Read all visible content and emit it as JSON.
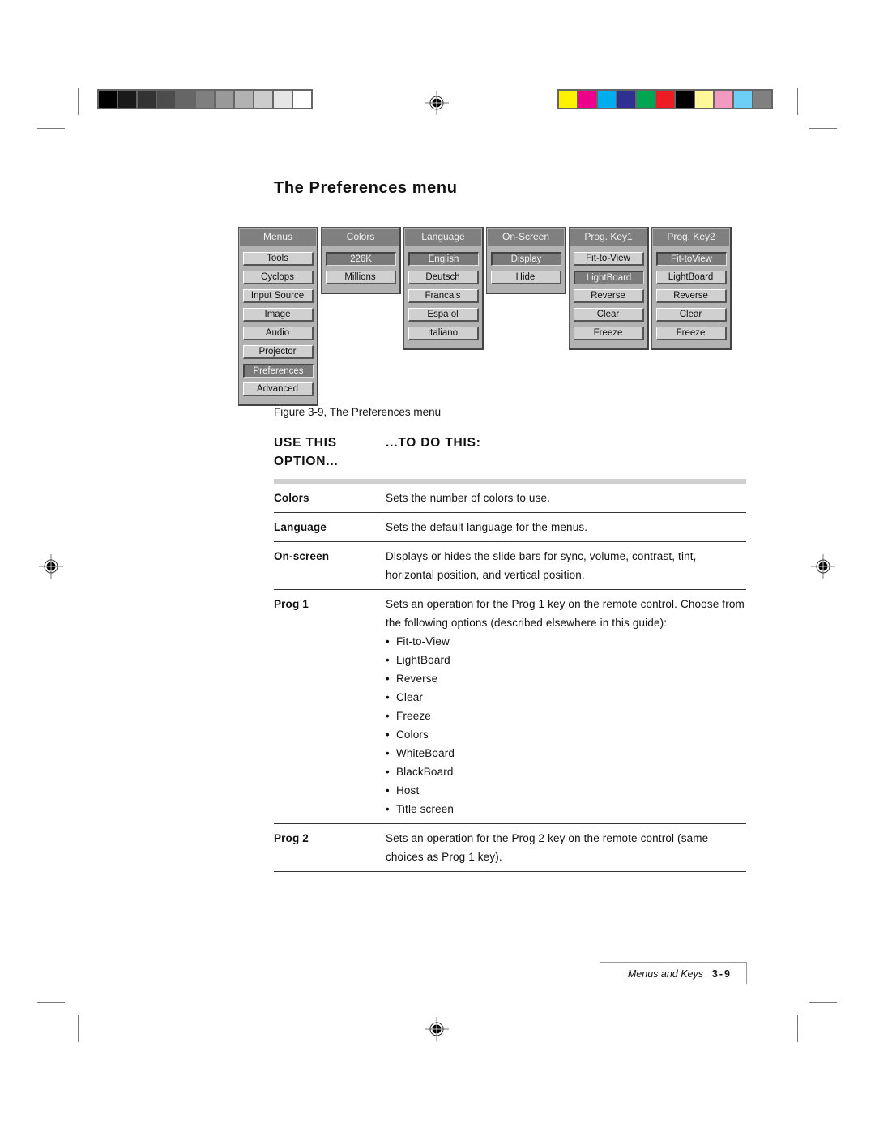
{
  "printer_marks": {
    "gray_swatches": [
      "#000000",
      "#1a1a1a",
      "#333333",
      "#4d4d4d",
      "#666666",
      "#7f7f7f",
      "#999999",
      "#b2b2b2",
      "#cccccc",
      "#e6e6e6",
      "#ffffff"
    ],
    "color_swatches": [
      "#fff200",
      "#ec008c",
      "#00aeef",
      "#2e3192",
      "#00a651",
      "#ed1c24",
      "#000000",
      "#fff799",
      "#f49ac1",
      "#6dcff6",
      "#808080"
    ]
  },
  "page_title": "The Preferences menu",
  "figure": {
    "panels": [
      {
        "title": "Menus",
        "items": [
          {
            "label": "Tools",
            "selected": false
          },
          {
            "label": "Cyclops",
            "selected": false
          },
          {
            "label": "Input Source",
            "selected": false
          },
          {
            "label": "Image",
            "selected": false
          },
          {
            "label": "Audio",
            "selected": false
          },
          {
            "label": "Projector",
            "selected": false
          },
          {
            "label": "Preferences",
            "selected": true
          },
          {
            "label": "Advanced",
            "selected": false
          }
        ]
      },
      {
        "title": "Colors",
        "items": [
          {
            "label": "226K",
            "selected": true
          },
          {
            "label": "Millions",
            "selected": false
          }
        ]
      },
      {
        "title": "Language",
        "items": [
          {
            "label": "English",
            "selected": true
          },
          {
            "label": "Deutsch",
            "selected": false
          },
          {
            "label": "Francais",
            "selected": false
          },
          {
            "label": "Espa ol",
            "selected": false
          },
          {
            "label": "Italiano",
            "selected": false
          }
        ]
      },
      {
        "title": "On-Screen",
        "items": [
          {
            "label": "Display",
            "selected": true
          },
          {
            "label": "Hide",
            "selected": false
          }
        ]
      },
      {
        "title": "Prog. Key1",
        "items": [
          {
            "label": "Fit-to-View",
            "selected": false
          },
          {
            "label": "LightBoard",
            "selected": true
          },
          {
            "label": "Reverse",
            "selected": false
          },
          {
            "label": "Clear",
            "selected": false
          },
          {
            "label": "Freeze",
            "selected": false
          }
        ]
      },
      {
        "title": "Prog. Key2",
        "items": [
          {
            "label": "Fit-toView",
            "selected": true
          },
          {
            "label": "LightBoard",
            "selected": false
          },
          {
            "label": "Reverse",
            "selected": false
          },
          {
            "label": "Clear",
            "selected": false
          },
          {
            "label": "Freeze",
            "selected": false
          }
        ]
      }
    ],
    "caption": "Figure 3-9, The Preferences menu"
  },
  "table": {
    "header": {
      "col1_line1": "USE THIS",
      "col1_line2": "OPTION...",
      "col2": "...TO DO THIS:"
    },
    "rows": [
      {
        "term": "Colors",
        "desc": "Sets the number of colors to use."
      },
      {
        "term": "Language",
        "desc": "Sets the default language for the menus."
      },
      {
        "term": "On-screen",
        "desc": "Displays or hides the slide bars for sync, volume, contrast, tint, horizontal position, and vertical position."
      },
      {
        "term": "Prog 1",
        "desc": "Sets an operation for the Prog 1 key on the remote control. Choose from the following options (described elsewhere in this guide):",
        "bullets": [
          "Fit-to-View",
          "LightBoard",
          "Reverse",
          "Clear",
          "Freeze",
          "Colors",
          "WhiteBoard",
          "BlackBoard",
          "Host",
          "Title screen"
        ]
      },
      {
        "term": "Prog 2",
        "desc": "Sets an operation for the Prog 2 key on the remote control (same choices as Prog 1 key)."
      }
    ]
  },
  "footer": {
    "section": "Menus and Keys",
    "page": "3-9"
  }
}
